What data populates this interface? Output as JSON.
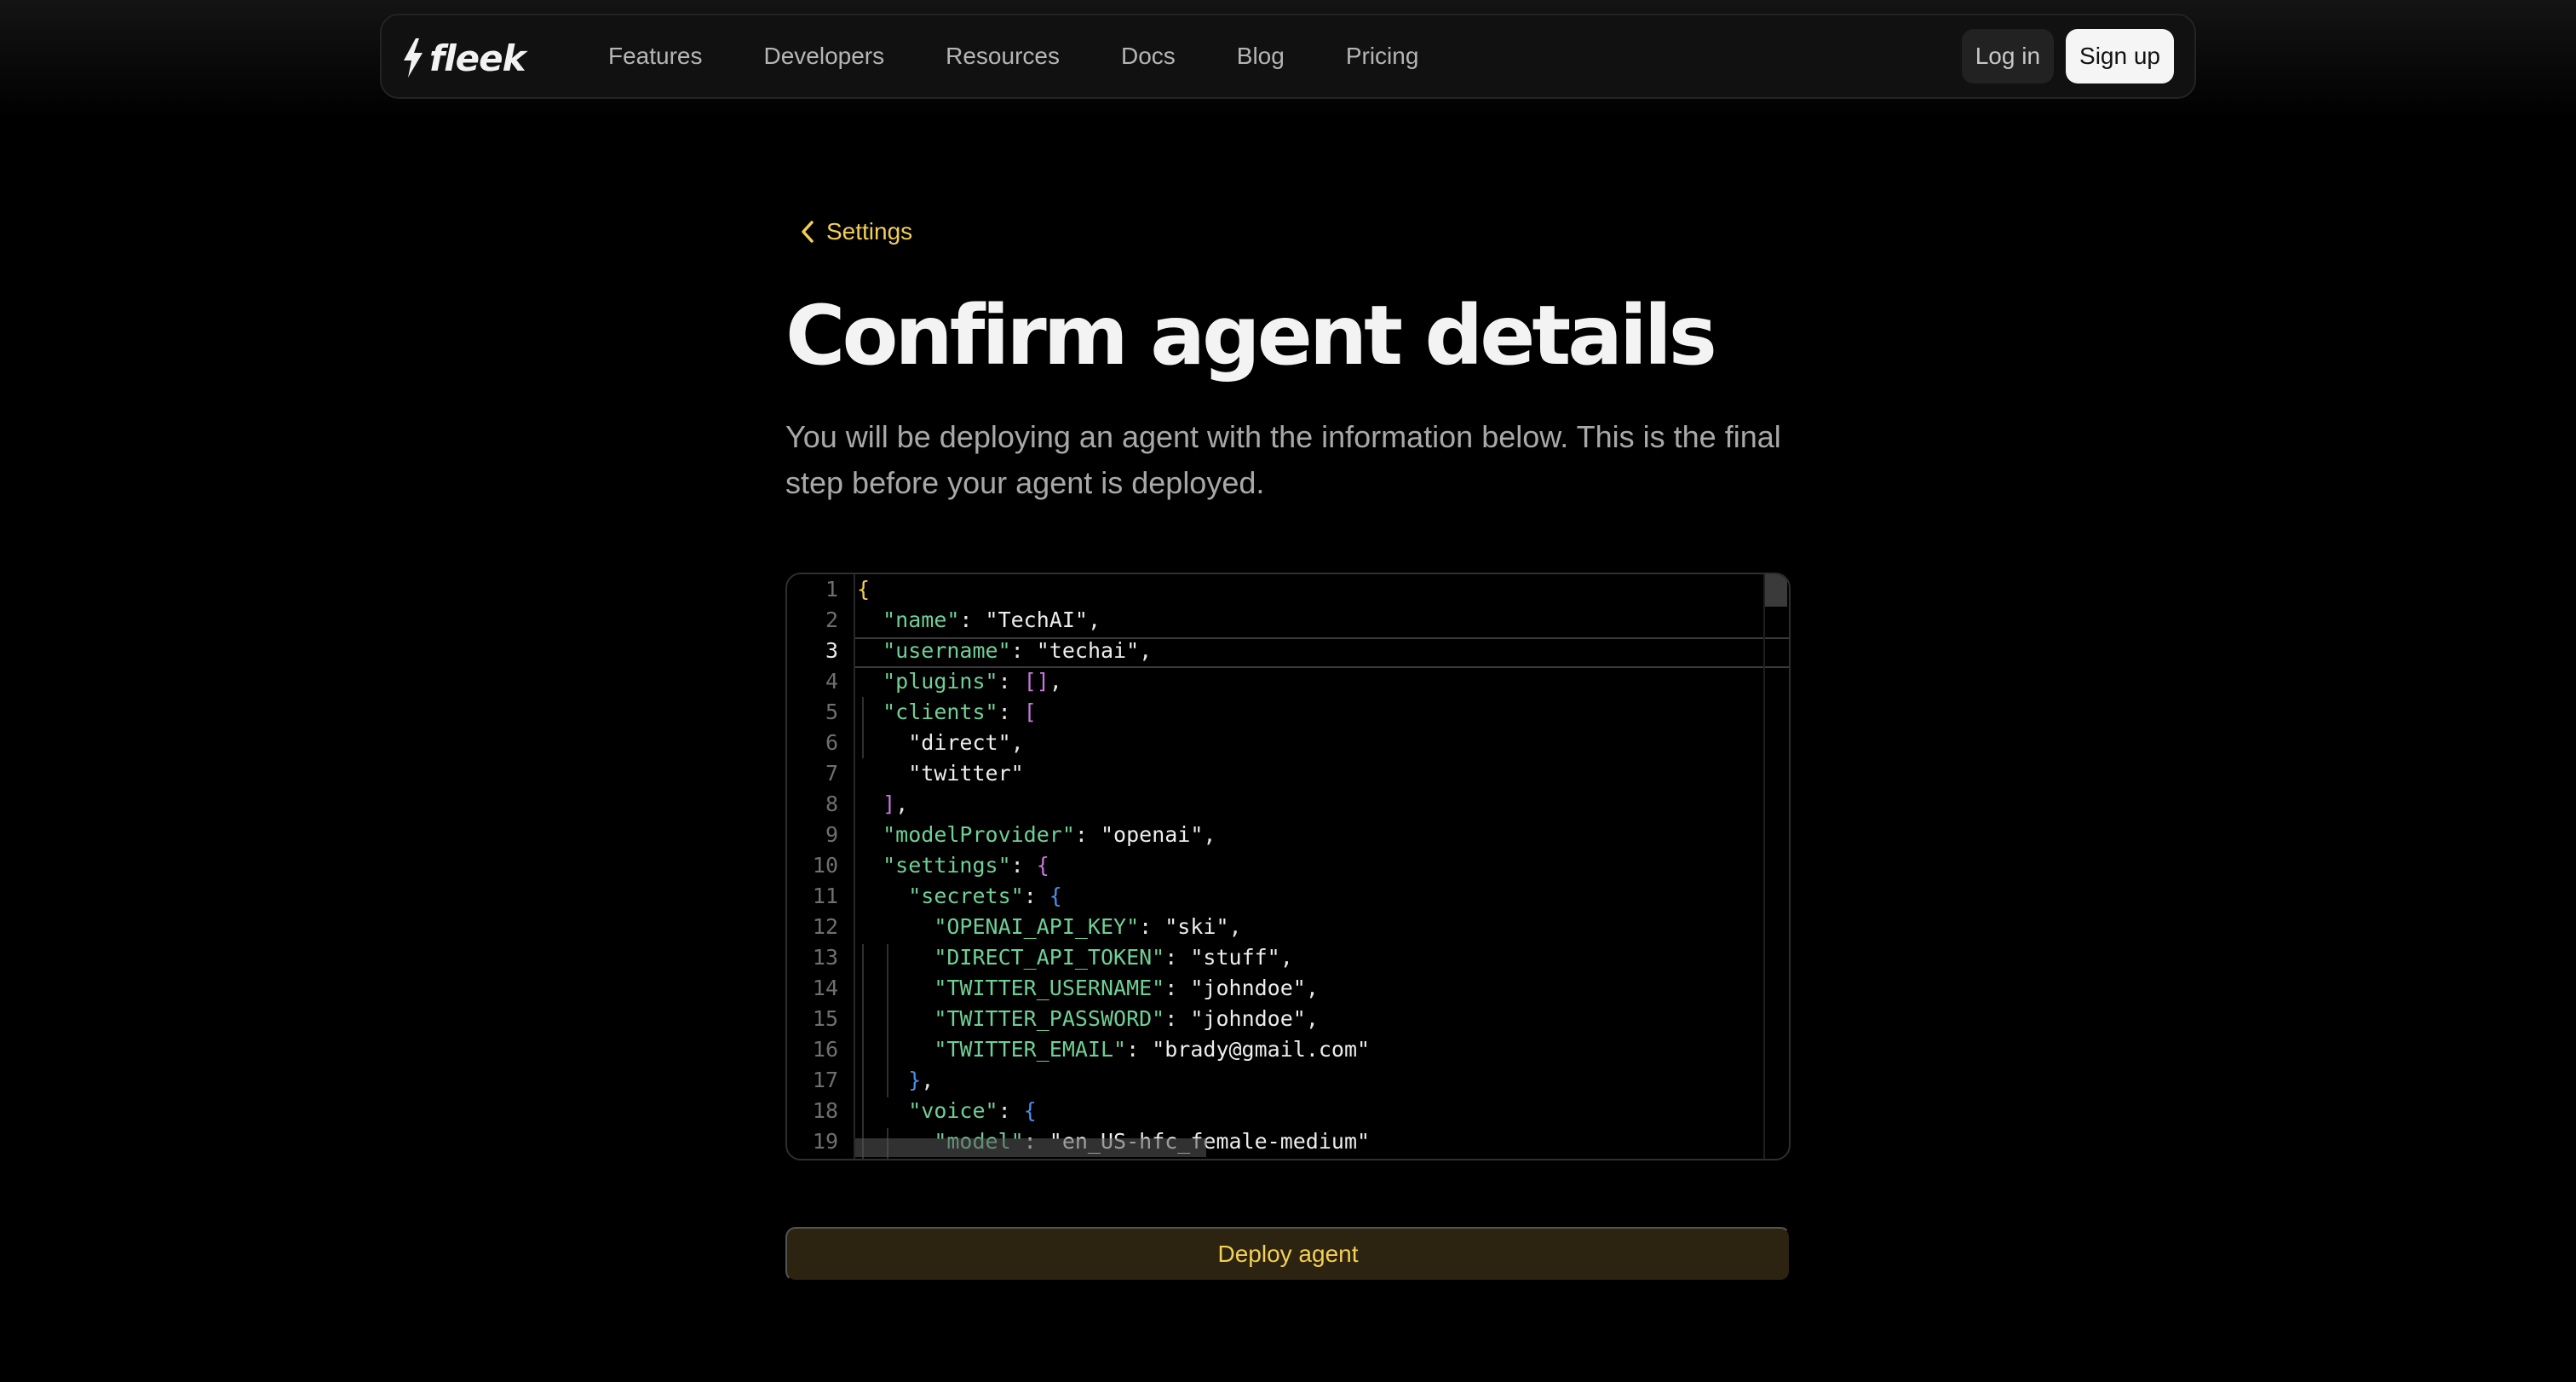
{
  "navbar": {
    "logo_text": "fleek",
    "links": [
      "Features",
      "Developers",
      "Resources",
      "Docs",
      "Blog",
      "Pricing"
    ],
    "login_label": "Log in",
    "signup_label": "Sign up"
  },
  "main": {
    "back_label": "Settings",
    "title": "Confirm agent details",
    "subtitle": "You will be deploying an agent with the information below. This is the final step before your agent is deployed.",
    "deploy_label": "Deploy agent"
  },
  "editor": {
    "active_line": 3,
    "lines": [
      [
        {
          "t": "{",
          "c": "b0"
        }
      ],
      [
        {
          "t": "  "
        },
        {
          "t": "\"name\"",
          "c": "k"
        },
        {
          "t": ": "
        },
        {
          "t": "\"TechAI\"",
          "c": "s"
        },
        {
          "t": ","
        }
      ],
      [
        {
          "t": "  "
        },
        {
          "t": "\"username\"",
          "c": "k"
        },
        {
          "t": ": "
        },
        {
          "t": "\"techai\"",
          "c": "s"
        },
        {
          "t": ","
        }
      ],
      [
        {
          "t": "  "
        },
        {
          "t": "\"plugins\"",
          "c": "k"
        },
        {
          "t": ": "
        },
        {
          "t": "[]",
          "c": "b1"
        },
        {
          "t": ","
        }
      ],
      [
        {
          "t": "  "
        },
        {
          "t": "\"clients\"",
          "c": "k"
        },
        {
          "t": ": "
        },
        {
          "t": "[",
          "c": "b1"
        }
      ],
      [
        {
          "t": "    "
        },
        {
          "t": "\"direct\"",
          "c": "s"
        },
        {
          "t": ","
        }
      ],
      [
        {
          "t": "    "
        },
        {
          "t": "\"twitter\"",
          "c": "s"
        }
      ],
      [
        {
          "t": "  "
        },
        {
          "t": "]",
          "c": "b1"
        },
        {
          "t": ","
        }
      ],
      [
        {
          "t": "  "
        },
        {
          "t": "\"modelProvider\"",
          "c": "k"
        },
        {
          "t": ": "
        },
        {
          "t": "\"openai\"",
          "c": "s"
        },
        {
          "t": ","
        }
      ],
      [
        {
          "t": "  "
        },
        {
          "t": "\"settings\"",
          "c": "k"
        },
        {
          "t": ": "
        },
        {
          "t": "{",
          "c": "b1"
        }
      ],
      [
        {
          "t": "    "
        },
        {
          "t": "\"secrets\"",
          "c": "k"
        },
        {
          "t": ": "
        },
        {
          "t": "{",
          "c": "b2"
        }
      ],
      [
        {
          "t": "      "
        },
        {
          "t": "\"OPENAI_API_KEY\"",
          "c": "k"
        },
        {
          "t": ": "
        },
        {
          "t": "\"ski\"",
          "c": "s"
        },
        {
          "t": ","
        }
      ],
      [
        {
          "t": "      "
        },
        {
          "t": "\"DIRECT_API_TOKEN\"",
          "c": "k"
        },
        {
          "t": ": "
        },
        {
          "t": "\"stuff\"",
          "c": "s"
        },
        {
          "t": ","
        }
      ],
      [
        {
          "t": "      "
        },
        {
          "t": "\"TWITTER_USERNAME\"",
          "c": "k"
        },
        {
          "t": ": "
        },
        {
          "t": "\"johndoe\"",
          "c": "s"
        },
        {
          "t": ","
        }
      ],
      [
        {
          "t": "      "
        },
        {
          "t": "\"TWITTER_PASSWORD\"",
          "c": "k"
        },
        {
          "t": ": "
        },
        {
          "t": "\"johndoe\"",
          "c": "s"
        },
        {
          "t": ","
        }
      ],
      [
        {
          "t": "      "
        },
        {
          "t": "\"TWITTER_EMAIL\"",
          "c": "k"
        },
        {
          "t": ": "
        },
        {
          "t": "\"brady@gmail.com\"",
          "c": "s"
        }
      ],
      [
        {
          "t": "    "
        },
        {
          "t": "}",
          "c": "b2"
        },
        {
          "t": ","
        }
      ],
      [
        {
          "t": "    "
        },
        {
          "t": "\"voice\"",
          "c": "k"
        },
        {
          "t": ": "
        },
        {
          "t": "{",
          "c": "b2"
        }
      ],
      [
        {
          "t": "      "
        },
        {
          "t": "\"model\"",
          "c": "k"
        },
        {
          "t": ": "
        },
        {
          "t": "\"en_US-hfc_female-medium\"",
          "c": "s"
        }
      ]
    ]
  },
  "colors": {
    "accent": "#f2cf55",
    "deploy_bg": "#2c2410",
    "json_key": "#6fcf97",
    "bracket_level1": "#c678dd",
    "bracket_level2": "#4f8fe8"
  },
  "icons": {
    "logo": "lightning-bolt-icon",
    "back": "chevron-left-icon"
  }
}
